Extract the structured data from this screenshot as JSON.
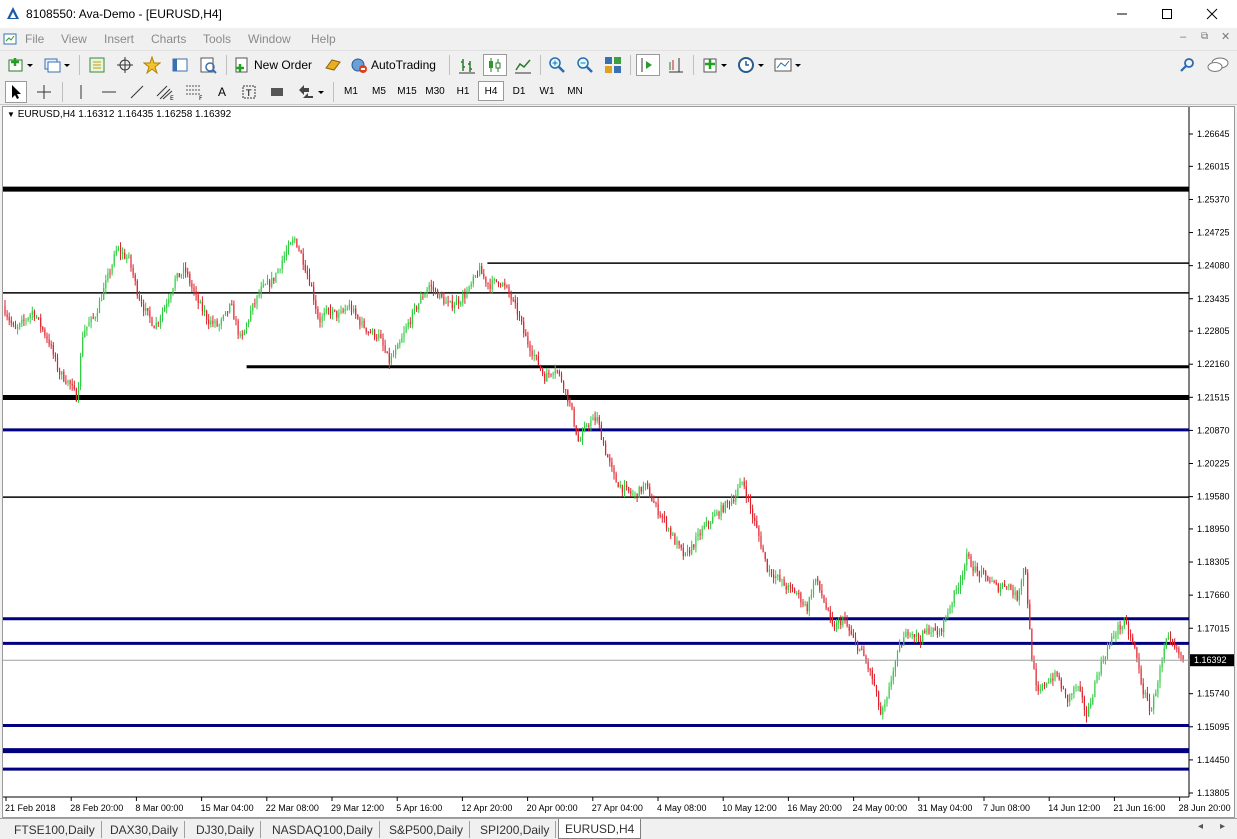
{
  "window": {
    "title": "8108550: Ava-Demo - [EURUSD,H4]"
  },
  "menu": [
    "File",
    "View",
    "Insert",
    "Charts",
    "Tools",
    "Window",
    "Help"
  ],
  "toolbar": {
    "new_order": "New Order",
    "auto_trading": "AutoTrading"
  },
  "timeframes": [
    "M1",
    "M5",
    "M15",
    "M30",
    "H1",
    "H4",
    "D1",
    "W1",
    "MN"
  ],
  "active_timeframe": "H4",
  "chart": {
    "info": "EURUSD,H4  1.16312 1.16435 1.16258 1.16392",
    "current_price": "1.16392",
    "price_labels": [
      "1.26645",
      "1.26015",
      "1.25370",
      "1.24725",
      "1.24080",
      "1.23435",
      "1.22805",
      "1.22160",
      "1.21515",
      "1.20870",
      "1.20225",
      "1.19580",
      "1.18950",
      "1.18305",
      "1.17660",
      "1.17015",
      "1.16392",
      "1.15740",
      "1.15095",
      "1.14450",
      "1.13805"
    ],
    "time_labels": [
      "21 Feb 2018",
      "28 Feb 20:00",
      "8 Mar 00:00",
      "15 Mar 04:00",
      "22 Mar 08:00",
      "29 Mar 12:00",
      "5 Apr 16:00",
      "12 Apr 20:00",
      "20 Apr 00:00",
      "27 Apr 04:00",
      "4 May 08:00",
      "10 May 12:00",
      "16 May 20:00",
      "24 May 00:00",
      "31 May 04:00",
      "7 Jun 08:00",
      "14 Jun 12:00",
      "21 Jun 16:00",
      "28 Jun 20:00"
    ],
    "colors": {
      "bull": "#2ecc40",
      "bear": "#e0202a",
      "thin_line": "#000000",
      "blue_line": "#000080"
    },
    "horizontal_levels": [
      {
        "price": 1.2557,
        "color": "black",
        "weight": "thick",
        "from": "start"
      },
      {
        "price": 1.2413,
        "color": "black",
        "weight": "thin",
        "from": "12 Apr 20:00"
      },
      {
        "price": 1.2355,
        "color": "black",
        "weight": "thin",
        "from": "start"
      },
      {
        "price": 1.2211,
        "color": "black",
        "weight": "medium",
        "from": "15 Mar 04:00"
      },
      {
        "price": 1.2151,
        "color": "black",
        "weight": "thick",
        "from": "start"
      },
      {
        "price": 1.2088,
        "color": "blue",
        "weight": "medium",
        "from": "start"
      },
      {
        "price": 1.1957,
        "color": "black",
        "weight": "thin",
        "from": "start"
      },
      {
        "price": 1.172,
        "color": "blue",
        "weight": "medium",
        "from": "start"
      },
      {
        "price": 1.1672,
        "color": "blue",
        "weight": "medium",
        "from": "start"
      },
      {
        "price": 1.1512,
        "color": "blue",
        "weight": "medium",
        "from": "start"
      },
      {
        "price": 1.1463,
        "color": "blue",
        "weight": "thick",
        "from": "start"
      },
      {
        "price": 1.1427,
        "color": "blue",
        "weight": "medium",
        "from": "start"
      }
    ],
    "path_points": [
      [
        0,
        1.233
      ],
      [
        12,
        1.228
      ],
      [
        30,
        1.232
      ],
      [
        46,
        1.226
      ],
      [
        56,
        1.22
      ],
      [
        66,
        1.218
      ],
      [
        74,
        1.215
      ],
      [
        80,
        1.228
      ],
      [
        92,
        1.231
      ],
      [
        104,
        1.238
      ],
      [
        114,
        1.244
      ],
      [
        126,
        1.242
      ],
      [
        134,
        1.236
      ],
      [
        142,
        1.232
      ],
      [
        152,
        1.229
      ],
      [
        162,
        1.233
      ],
      [
        172,
        1.238
      ],
      [
        182,
        1.24
      ],
      [
        194,
        1.234
      ],
      [
        206,
        1.23
      ],
      [
        216,
        1.229
      ],
      [
        228,
        1.233
      ],
      [
        238,
        1.226
      ],
      [
        248,
        1.232
      ],
      [
        258,
        1.236
      ],
      [
        270,
        1.238
      ],
      [
        282,
        1.243
      ],
      [
        292,
        1.246
      ],
      [
        300,
        1.242
      ],
      [
        308,
        1.237
      ],
      [
        316,
        1.23
      ],
      [
        326,
        1.232
      ],
      [
        336,
        1.231
      ],
      [
        346,
        1.233
      ],
      [
        356,
        1.23
      ],
      [
        366,
        1.228
      ],
      [
        376,
        1.227
      ],
      [
        386,
        1.222
      ],
      [
        396,
        1.225
      ],
      [
        404,
        1.229
      ],
      [
        414,
        1.233
      ],
      [
        426,
        1.237
      ],
      [
        436,
        1.235
      ],
      [
        446,
        1.233
      ],
      [
        456,
        1.234
      ],
      [
        466,
        1.236
      ],
      [
        476,
        1.24
      ],
      [
        486,
        1.237
      ],
      [
        496,
        1.238
      ],
      [
        504,
        1.236
      ],
      [
        514,
        1.232
      ],
      [
        522,
        1.227
      ],
      [
        532,
        1.223
      ],
      [
        542,
        1.219
      ],
      [
        552,
        1.221
      ],
      [
        560,
        1.218
      ],
      [
        568,
        1.213
      ],
      [
        576,
        1.206
      ],
      [
        584,
        1.21
      ],
      [
        594,
        1.211
      ],
      [
        602,
        1.205
      ],
      [
        612,
        1.199
      ],
      [
        622,
        1.197
      ],
      [
        632,
        1.196
      ],
      [
        642,
        1.198
      ],
      [
        652,
        1.194
      ],
      [
        662,
        1.191
      ],
      [
        672,
        1.187
      ],
      [
        682,
        1.184
      ],
      [
        692,
        1.187
      ],
      [
        702,
        1.19
      ],
      [
        712,
        1.192
      ],
      [
        722,
        1.194
      ],
      [
        732,
        1.196
      ],
      [
        740,
        1.199
      ],
      [
        748,
        1.193
      ],
      [
        756,
        1.188
      ],
      [
        764,
        1.182
      ],
      [
        774,
        1.18
      ],
      [
        784,
        1.178
      ],
      [
        794,
        1.177
      ],
      [
        804,
        1.174
      ],
      [
        812,
        1.18
      ],
      [
        820,
        1.176
      ],
      [
        830,
        1.17
      ],
      [
        840,
        1.172
      ],
      [
        850,
        1.168
      ],
      [
        860,
        1.165
      ],
      [
        870,
        1.16
      ],
      [
        878,
        1.153
      ],
      [
        884,
        1.156
      ],
      [
        890,
        1.162
      ],
      [
        898,
        1.167
      ],
      [
        906,
        1.17
      ],
      [
        916,
        1.168
      ],
      [
        926,
        1.17
      ],
      [
        936,
        1.169
      ],
      [
        946,
        1.174
      ],
      [
        956,
        1.179
      ],
      [
        964,
        1.184
      ],
      [
        974,
        1.181
      ],
      [
        984,
        1.18
      ],
      [
        994,
        1.178
      ],
      [
        1004,
        1.179
      ],
      [
        1014,
        1.176
      ],
      [
        1022,
        1.183
      ],
      [
        1028,
        1.166
      ],
      [
        1034,
        1.157
      ],
      [
        1044,
        1.16
      ],
      [
        1054,
        1.161
      ],
      [
        1064,
        1.156
      ],
      [
        1074,
        1.159
      ],
      [
        1084,
        1.153
      ],
      [
        1094,
        1.161
      ],
      [
        1104,
        1.166
      ],
      [
        1114,
        1.17
      ],
      [
        1122,
        1.171
      ],
      [
        1132,
        1.166
      ],
      [
        1140,
        1.158
      ],
      [
        1148,
        1.154
      ],
      [
        1156,
        1.161
      ],
      [
        1164,
        1.168
      ],
      [
        1172,
        1.166
      ],
      [
        1180,
        1.164
      ],
      [
        1184,
        1.1639
      ]
    ]
  },
  "tabs": [
    "FTSE100,Daily",
    "DAX30,Daily",
    "DJ30,Daily",
    "NASDAQ100,Daily",
    "S&P500,Daily",
    "SPI200,Daily",
    "EURUSD,H4"
  ],
  "active_tab": "EURUSD,H4"
}
